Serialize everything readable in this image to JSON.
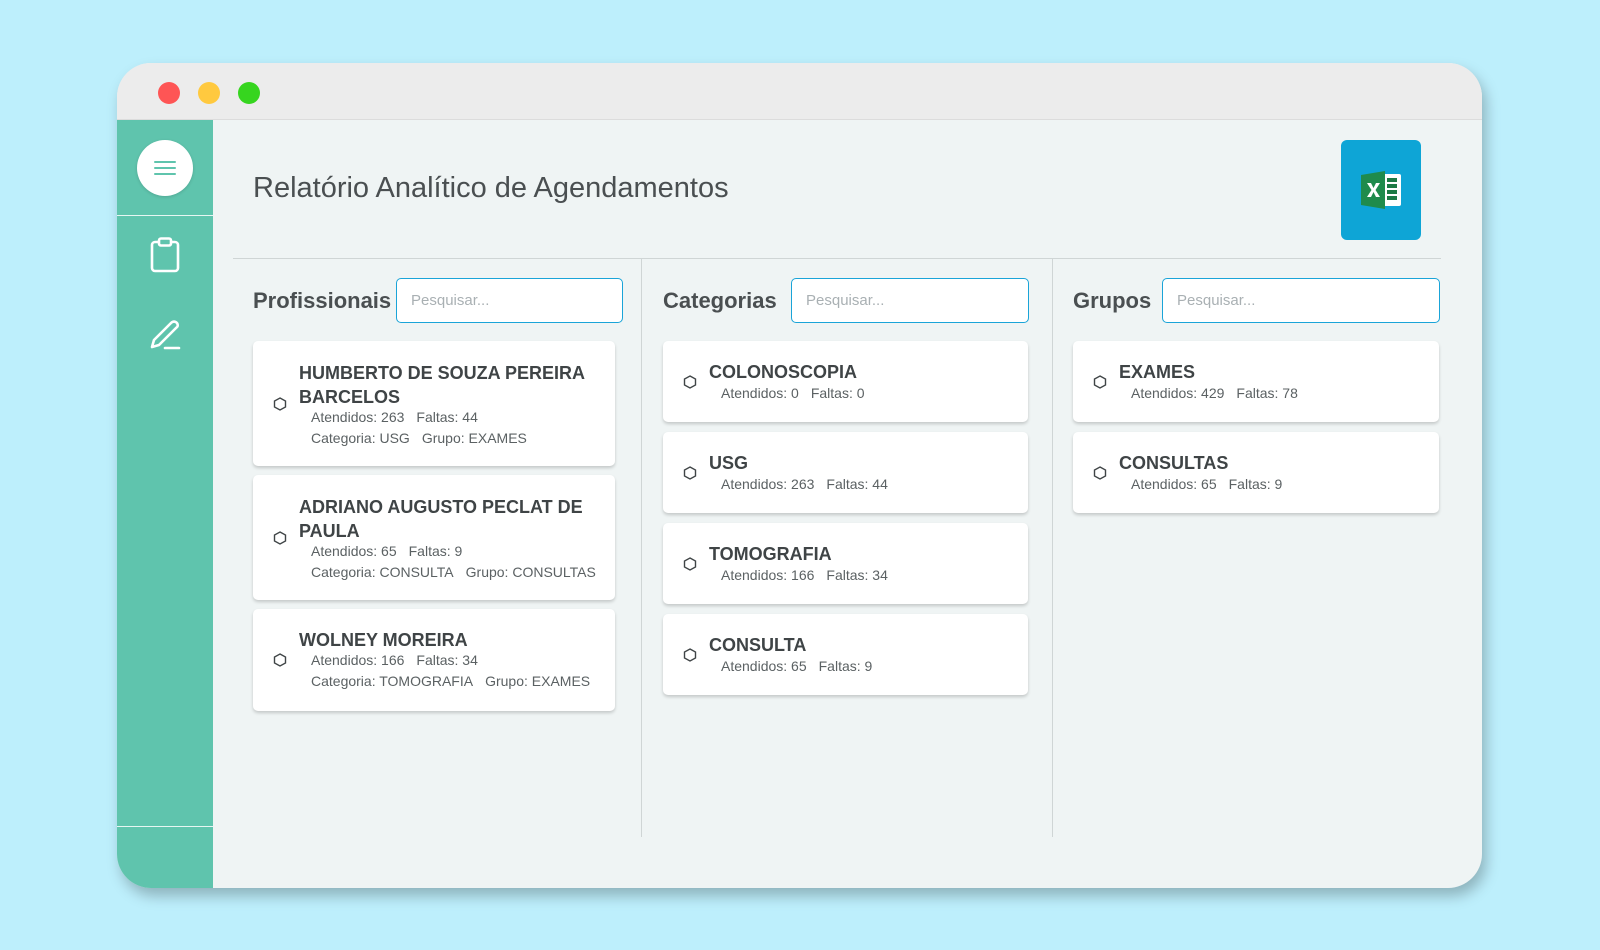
{
  "window": {
    "controls": [
      "close",
      "minimize",
      "maximize"
    ]
  },
  "sidebar": {
    "icons": [
      "menu-icon",
      "clipboard-icon",
      "pencil-icon"
    ],
    "accent": "#5fc4ad"
  },
  "header": {
    "title": "Relatório Analítico de Agendamentos",
    "export_icon": "excel-icon"
  },
  "columns": {
    "profissionais": {
      "title": "Profissionais",
      "search_placeholder": "Pesquisar...",
      "items": [
        {
          "name_line1": "HUMBERTO DE SOUZA PEREIRA",
          "name_line2": "BARCELOS",
          "atendidos": "Atendidos: 263",
          "faltas": "Faltas: 44",
          "categoria": "Categoria: USG",
          "grupo": "Grupo: EXAMES"
        },
        {
          "name_line1": "ADRIANO AUGUSTO PECLAT DE",
          "name_line2": "PAULA",
          "atendidos": "Atendidos: 65",
          "faltas": "Faltas: 9",
          "categoria": "Categoria: CONSULTA",
          "grupo": "Grupo: CONSULTAS"
        },
        {
          "name_line1": "WOLNEY MOREIRA",
          "name_line2": "",
          "atendidos": "Atendidos: 166",
          "faltas": "Faltas: 34",
          "categoria": "Categoria: TOMOGRAFIA",
          "grupo": "Grupo: EXAMES"
        }
      ]
    },
    "categorias": {
      "title": "Categorias",
      "search_placeholder": "Pesquisar...",
      "items": [
        {
          "name": "COLONOSCOPIA",
          "atendidos": "Atendidos: 0",
          "faltas": "Faltas: 0"
        },
        {
          "name": "USG",
          "atendidos": "Atendidos: 263",
          "faltas": "Faltas: 44"
        },
        {
          "name": "TOMOGRAFIA",
          "atendidos": "Atendidos: 166",
          "faltas": "Faltas: 34"
        },
        {
          "name": "CONSULTA",
          "atendidos": "Atendidos: 65",
          "faltas": "Faltas: 9"
        }
      ]
    },
    "grupos": {
      "title": "Grupos",
      "search_placeholder": "Pesquisar...",
      "items": [
        {
          "name": "EXAMES",
          "atendidos": "Atendidos: 429",
          "faltas": "Faltas: 78"
        },
        {
          "name": "CONSULTAS",
          "atendidos": "Atendidos: 65",
          "faltas": "Faltas: 9"
        }
      ]
    }
  },
  "colors": {
    "background": "#bdeffc",
    "excel_button": "#0ea5d6",
    "search_border": "#1aa4d8"
  }
}
